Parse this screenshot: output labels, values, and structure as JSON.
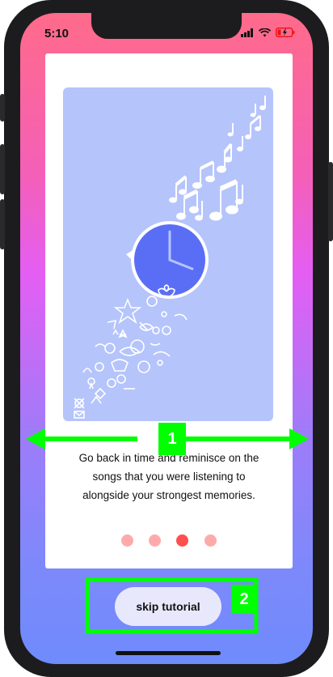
{
  "status_bar": {
    "time": "5:10"
  },
  "tutorial": {
    "text_lines": [
      "Go back in time and reminisce on the",
      "songs that you were listening to",
      "alongside your strongest memories."
    ],
    "page_count": 4,
    "active_page": 3
  },
  "skip_button": {
    "label": "skip tutorial"
  },
  "annotations": {
    "label_1": "1",
    "label_2": "2"
  },
  "colors": {
    "accent": "#ff4f4f",
    "dot_inactive": "#ffaaaa",
    "annotation": "#00ff00",
    "illustration_bg": "#b5c4fb",
    "clock": "#5a6ef5"
  }
}
